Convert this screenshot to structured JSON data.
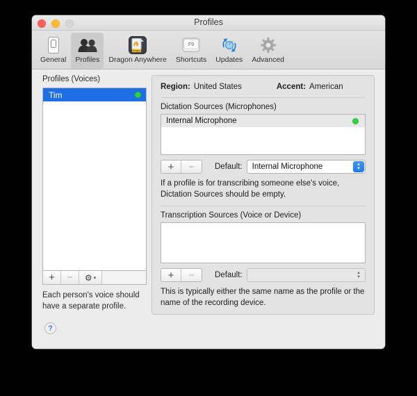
{
  "window": {
    "title": "Profiles",
    "traffic_lights": [
      "close-button",
      "minimize-button",
      "zoom-button"
    ]
  },
  "toolbar": {
    "items": [
      {
        "label": "General",
        "icon": "switch-icon",
        "selected": false
      },
      {
        "label": "Profiles",
        "icon": "people-icon",
        "selected": true
      },
      {
        "label": "Dragon Anywhere",
        "icon": "dragon-app-icon",
        "selected": false
      },
      {
        "label": "Shortcuts",
        "icon": "f9-key-icon",
        "selected": false
      },
      {
        "label": "Updates",
        "icon": "refresh-globe-icon",
        "selected": false
      },
      {
        "label": "Advanced",
        "icon": "gear-icon",
        "selected": false
      }
    ],
    "dragon_icon_text": "Dragon",
    "f9_key_text": "F9"
  },
  "sidebar": {
    "title": "Profiles (Voices)",
    "profiles": [
      {
        "name": "Tim",
        "selected": true,
        "status": "active"
      }
    ],
    "buttons": {
      "add": "+",
      "remove": "−",
      "action_gear": "⚙",
      "action_chevron": "▾"
    },
    "help_text": "Each person's voice should have a separate profile."
  },
  "details": {
    "region_label": "Region:",
    "region_value": "United States",
    "accent_label": "Accent:",
    "accent_value": "American",
    "dictation": {
      "title": "Dictation Sources (Microphones)",
      "rows": [
        {
          "name": "Internal Microphone",
          "status": "active"
        }
      ],
      "add": "+",
      "remove": "−",
      "default_label": "Default:",
      "default_value": "Internal Microphone",
      "help_text": "If a profile is for transcribing someone else's voice, Dictation Sources should be empty."
    },
    "transcription": {
      "title": "Transcription Sources (Voice or Device)",
      "rows": [],
      "add": "+",
      "remove": "−",
      "default_label": "Default:",
      "default_value": "",
      "help_text": "This is typically either the same name as the profile or the name of the recording device."
    }
  },
  "help_button": {
    "label": "?"
  },
  "colors": {
    "selection_blue": "#1e6ee6",
    "status_green": "#2ad439",
    "stepper_blue": "#2f86ee",
    "window_bg": "#ececec",
    "panel_bg": "#e3e3e3"
  }
}
